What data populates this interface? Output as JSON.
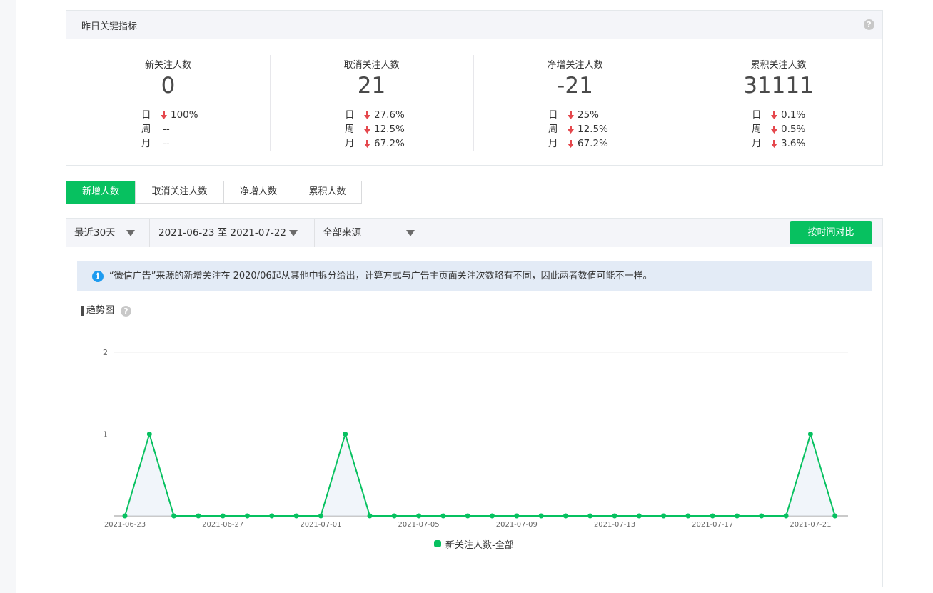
{
  "key_metrics": {
    "title": "昨日关键指标",
    "items": [
      {
        "label": "新关注人数",
        "value": "0",
        "rows": [
          {
            "period": "日",
            "change": "100%",
            "trend": "down"
          },
          {
            "period": "周",
            "change": "--",
            "trend": "none"
          },
          {
            "period": "月",
            "change": "--",
            "trend": "none"
          }
        ]
      },
      {
        "label": "取消关注人数",
        "value": "21",
        "rows": [
          {
            "period": "日",
            "change": "27.6%",
            "trend": "down"
          },
          {
            "period": "周",
            "change": "12.5%",
            "trend": "down"
          },
          {
            "period": "月",
            "change": "67.2%",
            "trend": "down"
          }
        ]
      },
      {
        "label": "净增关注人数",
        "value": "-21",
        "rows": [
          {
            "period": "日",
            "change": "25%",
            "trend": "down"
          },
          {
            "period": "周",
            "change": "12.5%",
            "trend": "down"
          },
          {
            "period": "月",
            "change": "67.2%",
            "trend": "down"
          }
        ]
      },
      {
        "label": "累积关注人数",
        "value": "31111",
        "rows": [
          {
            "period": "日",
            "change": "0.1%",
            "trend": "down"
          },
          {
            "period": "周",
            "change": "0.5%",
            "trend": "down"
          },
          {
            "period": "月",
            "change": "3.6%",
            "trend": "down"
          }
        ]
      }
    ]
  },
  "tabs": [
    {
      "label": "新增人数",
      "active": true
    },
    {
      "label": "取消关注人数",
      "active": false
    },
    {
      "label": "净增人数",
      "active": false
    },
    {
      "label": "累积人数",
      "active": false
    }
  ],
  "filters": {
    "range": "最近30天",
    "date_range": "2021-06-23 至 2021-07-22",
    "source": "全部来源",
    "compare_button": "按时间对比"
  },
  "notice": {
    "text": "“微信广告”来源的新增关注在 2020/06起从其他中拆分给出，计算方式与广告主页面关注次数略有不同，因此两者数值可能不一样。"
  },
  "trend": {
    "title": "趋势图"
  },
  "colors": {
    "accent": "#07c160",
    "down_arrow": "#e5484d",
    "notice_bg": "#e3ebf6",
    "info": "#1d9bf0"
  },
  "chart_data": {
    "type": "line",
    "x": [
      "2021-06-23",
      "2021-06-24",
      "2021-06-25",
      "2021-06-26",
      "2021-06-27",
      "2021-06-28",
      "2021-06-29",
      "2021-06-30",
      "2021-07-01",
      "2021-07-02",
      "2021-07-03",
      "2021-07-04",
      "2021-07-05",
      "2021-07-06",
      "2021-07-07",
      "2021-07-08",
      "2021-07-09",
      "2021-07-10",
      "2021-07-11",
      "2021-07-12",
      "2021-07-13",
      "2021-07-14",
      "2021-07-15",
      "2021-07-16",
      "2021-07-17",
      "2021-07-18",
      "2021-07-19",
      "2021-07-20",
      "2021-07-21",
      "2021-07-22"
    ],
    "x_ticks": [
      "2021-06-23",
      "2021-06-27",
      "2021-07-01",
      "2021-07-05",
      "2021-07-09",
      "2021-07-13",
      "2021-07-17",
      "2021-07-21"
    ],
    "series": [
      {
        "name": "新关注人数-全部",
        "values": [
          0,
          1,
          0,
          0,
          0,
          0,
          0,
          0,
          0,
          1,
          0,
          0,
          0,
          0,
          0,
          0,
          0,
          0,
          0,
          0,
          0,
          0,
          0,
          0,
          0,
          0,
          0,
          0,
          1,
          0
        ]
      }
    ],
    "y_ticks": [
      1,
      2
    ],
    "ylim": [
      0,
      2
    ],
    "grid": true,
    "legend": "bottom-center"
  }
}
